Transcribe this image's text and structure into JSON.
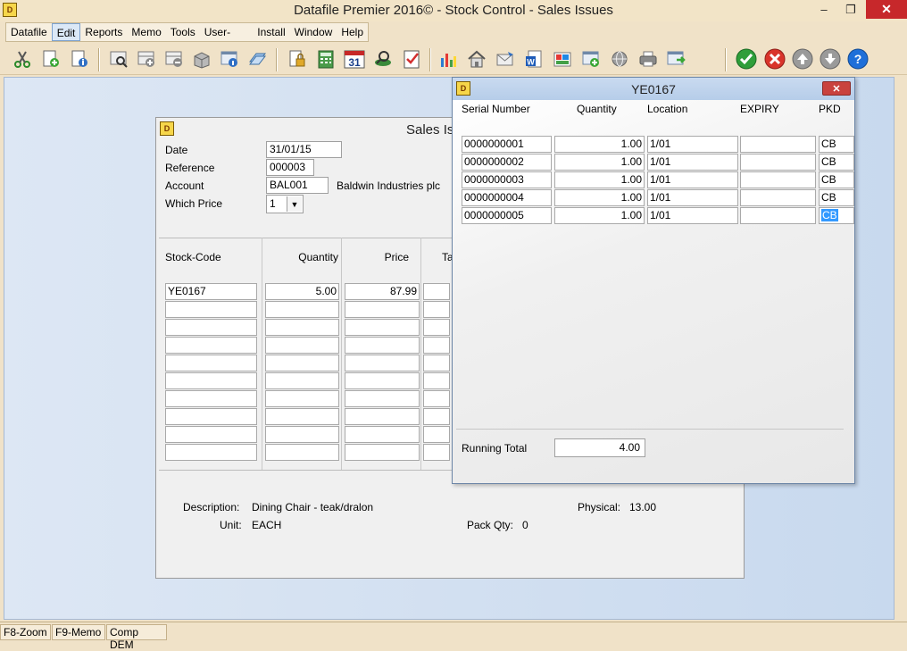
{
  "window": {
    "title": "Datafile  Premier 2016© - Stock Control - Sales Issues",
    "minimize": "–",
    "restore": "❐",
    "close": "✕"
  },
  "menu": {
    "items": [
      {
        "label": "Datafile"
      },
      {
        "label": "Edit"
      },
      {
        "label": "Reports"
      },
      {
        "label": "Memo"
      },
      {
        "label": "Tools"
      },
      {
        "label": "User-Routines"
      },
      {
        "label": "Install"
      },
      {
        "label": "Window"
      },
      {
        "label": "Help"
      }
    ]
  },
  "toolbar": {
    "icons": [
      "cut-icon",
      "new-record-icon",
      "info-icon",
      "find-icon",
      "add-row-icon",
      "remove-row-icon",
      "archive-icon",
      "report-info-icon",
      "stack-icon",
      "lock-icon",
      "calculator-icon",
      "calendar-icon",
      "search-money-icon",
      "checklist-icon",
      "chart-icon",
      "home-icon",
      "email-icon",
      "word-icon",
      "gallery-icon",
      "add-window-icon",
      "globe-icon",
      "printer-icon",
      "export-icon",
      "ok-icon",
      "cancel-icon",
      "up-icon",
      "down-icon",
      "help-icon"
    ],
    "calendar_day": "31",
    "word_letter": "W",
    "help_glyph": "?"
  },
  "sales": {
    "title": "Sales Is",
    "date_label": "Date",
    "date_value": "31/01/15",
    "reference_label": "Reference",
    "reference_value": "000003",
    "account_label": "Account",
    "account_value": "BAL001",
    "account_name": "Baldwin Industries plc",
    "which_price_label": "Which Price",
    "which_price_value": "1",
    "grid": {
      "headers": {
        "stock_code": "Stock-Code",
        "quantity": "Quantity",
        "price": "Price",
        "tax": "Ta"
      },
      "rows": [
        {
          "stock_code": "YE0167",
          "quantity": "5.00",
          "price": "87.99",
          "tax": ""
        },
        {
          "stock_code": "",
          "quantity": "",
          "price": "",
          "tax": ""
        },
        {
          "stock_code": "",
          "quantity": "",
          "price": "",
          "tax": ""
        },
        {
          "stock_code": "",
          "quantity": "",
          "price": "",
          "tax": ""
        },
        {
          "stock_code": "",
          "quantity": "",
          "price": "",
          "tax": ""
        },
        {
          "stock_code": "",
          "quantity": "",
          "price": "",
          "tax": ""
        },
        {
          "stock_code": "",
          "quantity": "",
          "price": "",
          "tax": ""
        },
        {
          "stock_code": "",
          "quantity": "",
          "price": "",
          "tax": ""
        },
        {
          "stock_code": "",
          "quantity": "",
          "price": "",
          "tax": ""
        },
        {
          "stock_code": "",
          "quantity": "",
          "price": "",
          "tax": ""
        }
      ]
    },
    "description_label": "Description:",
    "description_value": "Dining Chair - teak/dralon",
    "unit_label": "Unit:",
    "unit_value": "EACH",
    "pack_qty_label": "Pack Qty:",
    "pack_qty_value": "0",
    "physical_label": "Physical:",
    "physical_value": "13.00"
  },
  "serial": {
    "title": "YE0167",
    "close": "✕",
    "headers": {
      "serial": "Serial Number",
      "quantity": "Quantity",
      "location": "Location",
      "expiry": "EXPIRY",
      "pkd": "PKD"
    },
    "rows": [
      {
        "serial": "0000000001",
        "quantity": "1.00",
        "location": "1/01",
        "expiry": "",
        "pkd": "CB"
      },
      {
        "serial": "0000000002",
        "quantity": "1.00",
        "location": "1/01",
        "expiry": "",
        "pkd": "CB"
      },
      {
        "serial": "0000000003",
        "quantity": "1.00",
        "location": "1/01",
        "expiry": "",
        "pkd": "CB"
      },
      {
        "serial": "0000000004",
        "quantity": "1.00",
        "location": "1/01",
        "expiry": "",
        "pkd": "CB"
      },
      {
        "serial": "0000000005",
        "quantity": "1.00",
        "location": "1/01",
        "expiry": "",
        "pkd": "CB"
      }
    ],
    "running_total_label": "Running Total",
    "running_total_value": "4.00"
  },
  "status": {
    "f8": "F8-Zoom",
    "f9": "F9-Memo",
    "company": "Comp DEM"
  },
  "app_icon_glyph": "D"
}
